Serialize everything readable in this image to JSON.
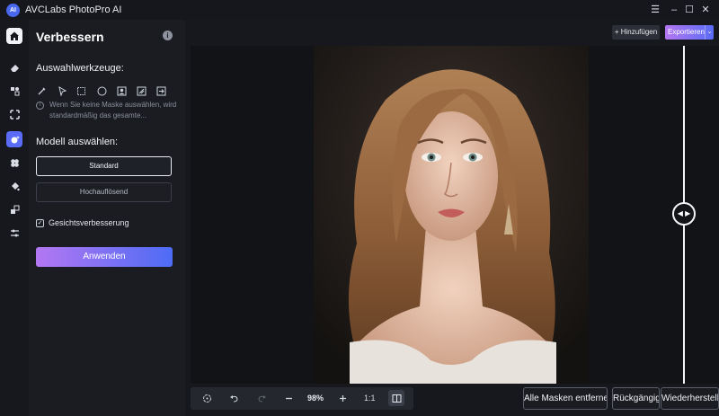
{
  "app": {
    "title": "AVCLabs PhotoPro AI",
    "logo_text": "AI"
  },
  "window_controls": {
    "menu": "☰",
    "minimize": "–",
    "maximize": "☐",
    "close": "✕"
  },
  "rail": {
    "items": [
      "home-icon",
      "eraser-icon",
      "replace-icon",
      "upscale-icon",
      "enhance-icon",
      "colorize-icon",
      "fill-icon",
      "crop-icon",
      "adjust-icon"
    ]
  },
  "panel": {
    "title": "Verbessern",
    "info_icon": "i",
    "selection_tools_label": "Auswahlwerkzeuge:",
    "tools": [
      "brush-icon",
      "pointer-icon",
      "rectangle-icon",
      "ellipse-icon",
      "portrait-icon",
      "auto-select-icon",
      "import-mask-icon"
    ],
    "hint": "Wenn Sie keine Maske auswählen, wird standardmäßig das gesamte...",
    "model_label": "Modell auswählen:",
    "model_options": [
      "Standard",
      "Hochauflösend"
    ],
    "selected_model": "Standard",
    "face_enhancement": {
      "label": "Gesichtsverbesserung",
      "checked": true,
      "mark": "✓"
    },
    "apply_label": "Anwenden"
  },
  "toolbar": {
    "add_label": "+ Hinzufügen",
    "export_label": "Exportieren",
    "export_arrow": "⌄"
  },
  "canvas": {
    "compare_handle": "◀ ▶"
  },
  "bottom_bar": {
    "zoom": "98%",
    "ratio": "1:1"
  },
  "actions": {
    "remove_masks": "Alle Masken entfernen",
    "undo": "Rückgängig",
    "redo": "Wiederherstellen"
  }
}
